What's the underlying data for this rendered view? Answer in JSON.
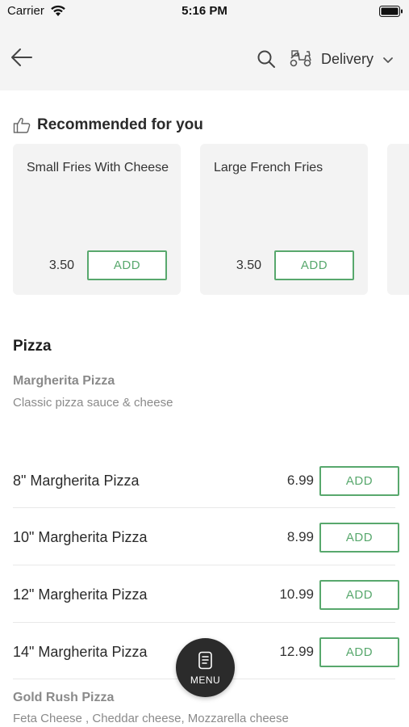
{
  "status_bar": {
    "carrier": "Carrier",
    "time": "5:16 PM"
  },
  "header": {
    "delivery_label": "Delivery"
  },
  "recommended": {
    "title": "Recommended for you",
    "items": [
      {
        "name": "Small Fries With Cheese",
        "price": "3.50",
        "add_label": "ADD"
      },
      {
        "name": "Large French Fries",
        "price": "3.50",
        "add_label": "ADD"
      }
    ]
  },
  "pizza": {
    "section_title": "Pizza",
    "groups": [
      {
        "title": "Margherita Pizza",
        "description": "Classic pizza sauce & cheese",
        "items": [
          {
            "name": "8\" Margherita Pizza",
            "price": "6.99",
            "add_label": "ADD"
          },
          {
            "name": "10\" Margherita Pizza",
            "price": "8.99",
            "add_label": "ADD"
          },
          {
            "name": "12\" Margherita Pizza",
            "price": "10.99",
            "add_label": "ADD"
          },
          {
            "name": "14\" Margherita Pizza",
            "price": "12.99",
            "add_label": "ADD"
          }
        ]
      },
      {
        "title": "Gold Rush Pizza",
        "description": "Feta Cheese , Cheddar cheese, Mozzarella cheese"
      }
    ]
  },
  "menu_button": {
    "label": "MENU"
  },
  "colors": {
    "accent": "#58a86d",
    "header_bg": "#f4f4f4",
    "card_bg": "#f3f3f3",
    "fab_bg": "#2b2b2b"
  }
}
